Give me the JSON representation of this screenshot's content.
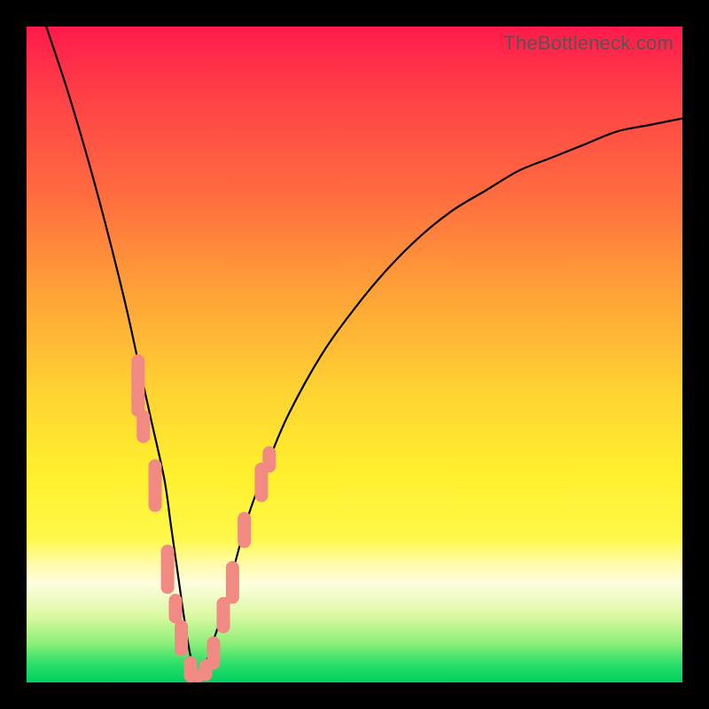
{
  "watermark": "TheBottleneck.com",
  "colors": {
    "frame": "#000000",
    "curve": "#000000",
    "marker": "#f08a82",
    "gradient_top": "#ff1a4b",
    "gradient_bottom": "#00d060"
  },
  "chart_data": {
    "type": "line",
    "title": "",
    "xlabel": "",
    "ylabel": "",
    "xlim": [
      0,
      100
    ],
    "ylim": [
      0,
      100
    ],
    "grid": false,
    "legend": false,
    "notes": "Bottleneck-style V curve. Axis values are in percent of plot width/height (0,0 at bottom-left). y represents bottleneck magnitude (0 = optimal/green, 100 = worst/red). Minimum ~26% along x.",
    "series": [
      {
        "name": "bottleneck_curve",
        "x": [
          3,
          6,
          9,
          12,
          15,
          17,
          19,
          21,
          22,
          23,
          24,
          25,
          26,
          27,
          28,
          30,
          32,
          34,
          37,
          40,
          45,
          50,
          55,
          60,
          65,
          70,
          75,
          80,
          85,
          90,
          95,
          100
        ],
        "y": [
          100,
          91,
          81,
          70,
          58,
          49,
          40,
          31,
          24,
          17,
          10,
          4,
          1,
          2,
          5,
          11,
          19,
          26,
          34,
          41,
          50,
          57,
          63,
          68,
          72,
          75,
          78,
          80,
          82,
          84,
          85,
          86
        ]
      }
    ],
    "markers": [
      {
        "x": 17.0,
        "y_top": 49.0,
        "y_bottom": 41.5
      },
      {
        "x": 17.8,
        "y_top": 40.5,
        "y_bottom": 37.5
      },
      {
        "x": 19.6,
        "y_top": 33.0,
        "y_bottom": 27.0
      },
      {
        "x": 21.5,
        "y_top": 20.0,
        "y_bottom": 14.5
      },
      {
        "x": 22.7,
        "y_top": 12.5,
        "y_bottom": 10.0
      },
      {
        "x": 23.6,
        "y_top": 8.5,
        "y_bottom": 5.0
      },
      {
        "x": 25.0,
        "y_top": 3.0,
        "y_bottom": 1.0
      },
      {
        "x": 26.2,
        "y_top": 1.0,
        "y_bottom": 1.0
      },
      {
        "x": 27.3,
        "y_top": 2.5,
        "y_bottom": 1.2
      },
      {
        "x": 28.5,
        "y_top": 6.0,
        "y_bottom": 3.0
      },
      {
        "x": 30.0,
        "y_top": 12.0,
        "y_bottom": 8.5
      },
      {
        "x": 31.4,
        "y_top": 17.5,
        "y_bottom": 13.0
      },
      {
        "x": 33.2,
        "y_top": 25.0,
        "y_bottom": 21.5
      },
      {
        "x": 35.8,
        "y_top": 32.5,
        "y_bottom": 28.5
      },
      {
        "x": 37.0,
        "y_top": 35.0,
        "y_bottom": 33.0
      }
    ]
  }
}
